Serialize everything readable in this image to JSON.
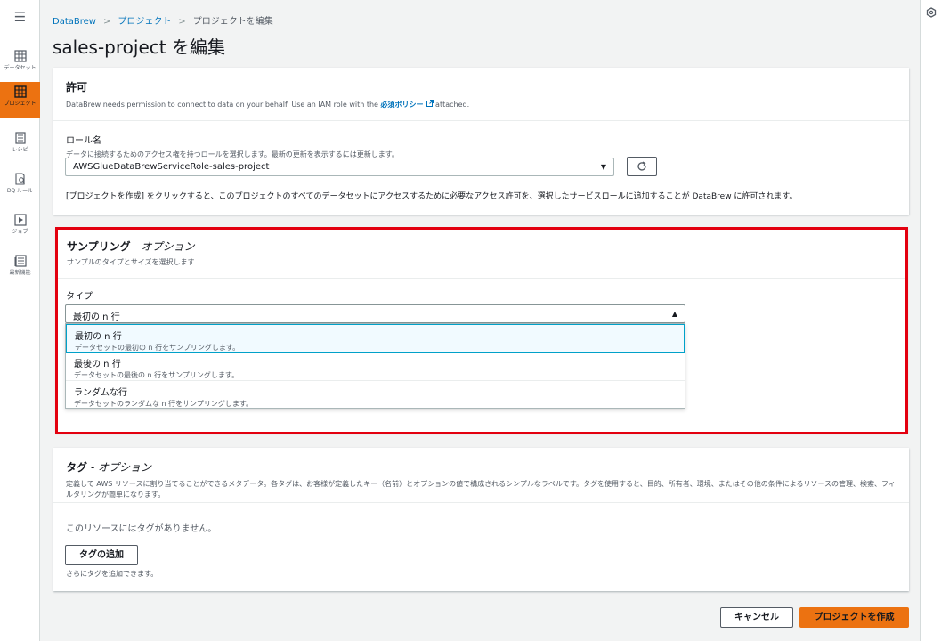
{
  "nav": {
    "menu_icon": "menu-icon",
    "items": [
      {
        "label": "データセット",
        "icon": "table-icon"
      },
      {
        "label": "プロジェクト",
        "icon": "grid-icon",
        "active": true
      },
      {
        "label": "レシピ",
        "icon": "list-icon"
      },
      {
        "label": "DQ ルール",
        "icon": "document-search-icon"
      },
      {
        "label": "ジョブ",
        "icon": "play-icon"
      },
      {
        "label": "最新機能",
        "icon": "newspaper-icon"
      }
    ],
    "right_icon": "settings-icon"
  },
  "breadcrumb": {
    "items": [
      "DataBrew",
      "プロジェクト",
      "プロジェクトを編集"
    ]
  },
  "page": {
    "title": "sales-project を編集"
  },
  "permissions": {
    "heading": "許可",
    "desc_before": "DataBrew needs permission to connect to data on your behalf. Use an IAM role with the ",
    "policy_link": "必須ポリシー",
    "desc_after": " attached.",
    "role_label": "ロール名",
    "role_hint": "データに接続するためのアクセス権を持つロールを選択します。最新の更新を表示するには更新します。",
    "role_value": "AWSGlueDataBrewServiceRole-sales-project",
    "permission_note": "[プロジェクトを作成] をクリックすると、このプロジェクトのすべてのデータセットにアクセスするために必要なアクセス許可を、選択したサービスロールに追加することが DataBrew に許可されます。"
  },
  "sampling": {
    "heading": "サンプリング",
    "heading_suffix": " - オプション",
    "desc": "サンプルのタイプとサイズを選択します",
    "type_label": "タイプ",
    "type_value": "最初の n 行",
    "options": [
      {
        "title": "最初の n 行",
        "desc": "データセットの最初の n 行をサンプリングします。"
      },
      {
        "title": "最後の n 行",
        "desc": "データセットの最後の n 行をサンプリングします。"
      },
      {
        "title": "ランダムな行",
        "desc": "データセットのランダムな n 行をサンプリングします。"
      }
    ]
  },
  "tags": {
    "heading": "タグ",
    "heading_suffix": " - オプション",
    "desc": "定義して AWS リソースに割り当てることができるメタデータ。各タグは、お客様が定義したキー（名前）とオプションの値で構成されるシンプルなラベルです。タグを使用すると、目的、所有者、環境、またはその他の条件によるリソースの管理、検索、フィルタリングが簡単になります。",
    "empty": "このリソースにはタグがありません。",
    "add_button": "タグの追加",
    "add_hint": "さらにタグを追加できます。"
  },
  "footer": {
    "cancel": "キャンセル",
    "create": "プロジェクトを作成"
  },
  "colors": {
    "accent": "#ec7211",
    "link": "#0073bb",
    "highlight": "#e3000f"
  }
}
